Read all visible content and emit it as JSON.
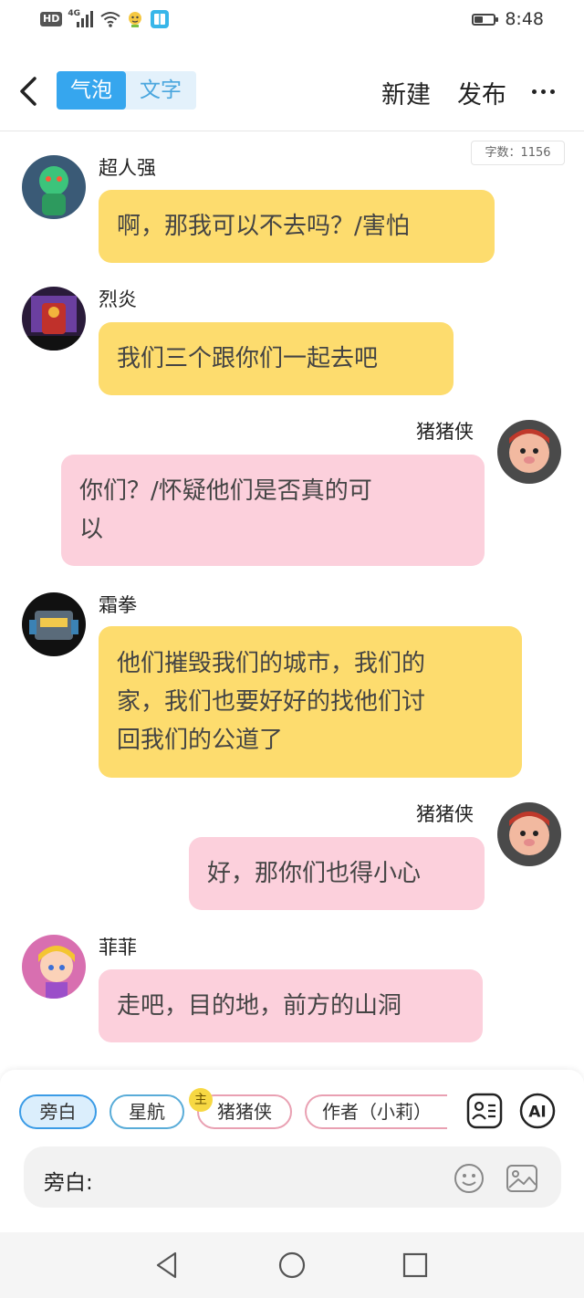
{
  "status_bar": {
    "network_badge": "HD",
    "signal_label": "4G",
    "time": "8:48",
    "icons": [
      "hd-icon",
      "signal-icon",
      "wifi-icon",
      "notification-icon",
      "book-app-icon",
      "battery-icon"
    ]
  },
  "header": {
    "tabs": [
      {
        "label": "气泡",
        "active": true
      },
      {
        "label": "文字",
        "active": false
      }
    ],
    "new_label": "新建",
    "publish_label": "发布"
  },
  "word_count": "字数：1156",
  "messages": [
    {
      "name": "超人强",
      "side": "left",
      "color": "yellow",
      "text": [
        "啊，那我可以不去吗？/害怕"
      ]
    },
    {
      "name": "烈炎",
      "side": "left",
      "color": "yellow",
      "text": [
        "我们三个跟你们一起去吧"
      ]
    },
    {
      "name": "猪猪侠",
      "side": "right",
      "color": "pink",
      "text": [
        "你们？/怀疑他们是否真的可",
        "以"
      ]
    },
    {
      "name": "霜拳",
      "side": "left",
      "color": "yellow",
      "text": [
        "他们摧毁我们的城市，我们的",
        "家，我们也要好好的找他们讨",
        "回我们的公道了"
      ]
    },
    {
      "name": "猪猪侠",
      "side": "right",
      "color": "pink",
      "text": [
        "好，那你们也得小心"
      ]
    },
    {
      "name": "菲菲",
      "side": "left",
      "color": "pink",
      "text": [
        "走吧，目的地，前方的山洞"
      ]
    }
  ],
  "roles": [
    {
      "label": "旁白",
      "selected": true
    },
    {
      "label": "星航",
      "selected": false
    },
    {
      "label": "猪猪侠",
      "selected": false,
      "badge": "主"
    },
    {
      "label": "作者（小莉）",
      "selected": false
    }
  ],
  "input": {
    "label": "旁白:"
  },
  "colors": {
    "accent": "#36a6ee",
    "bubble_yellow": "#fddc6e",
    "bubble_pink": "#fcd0dc"
  }
}
